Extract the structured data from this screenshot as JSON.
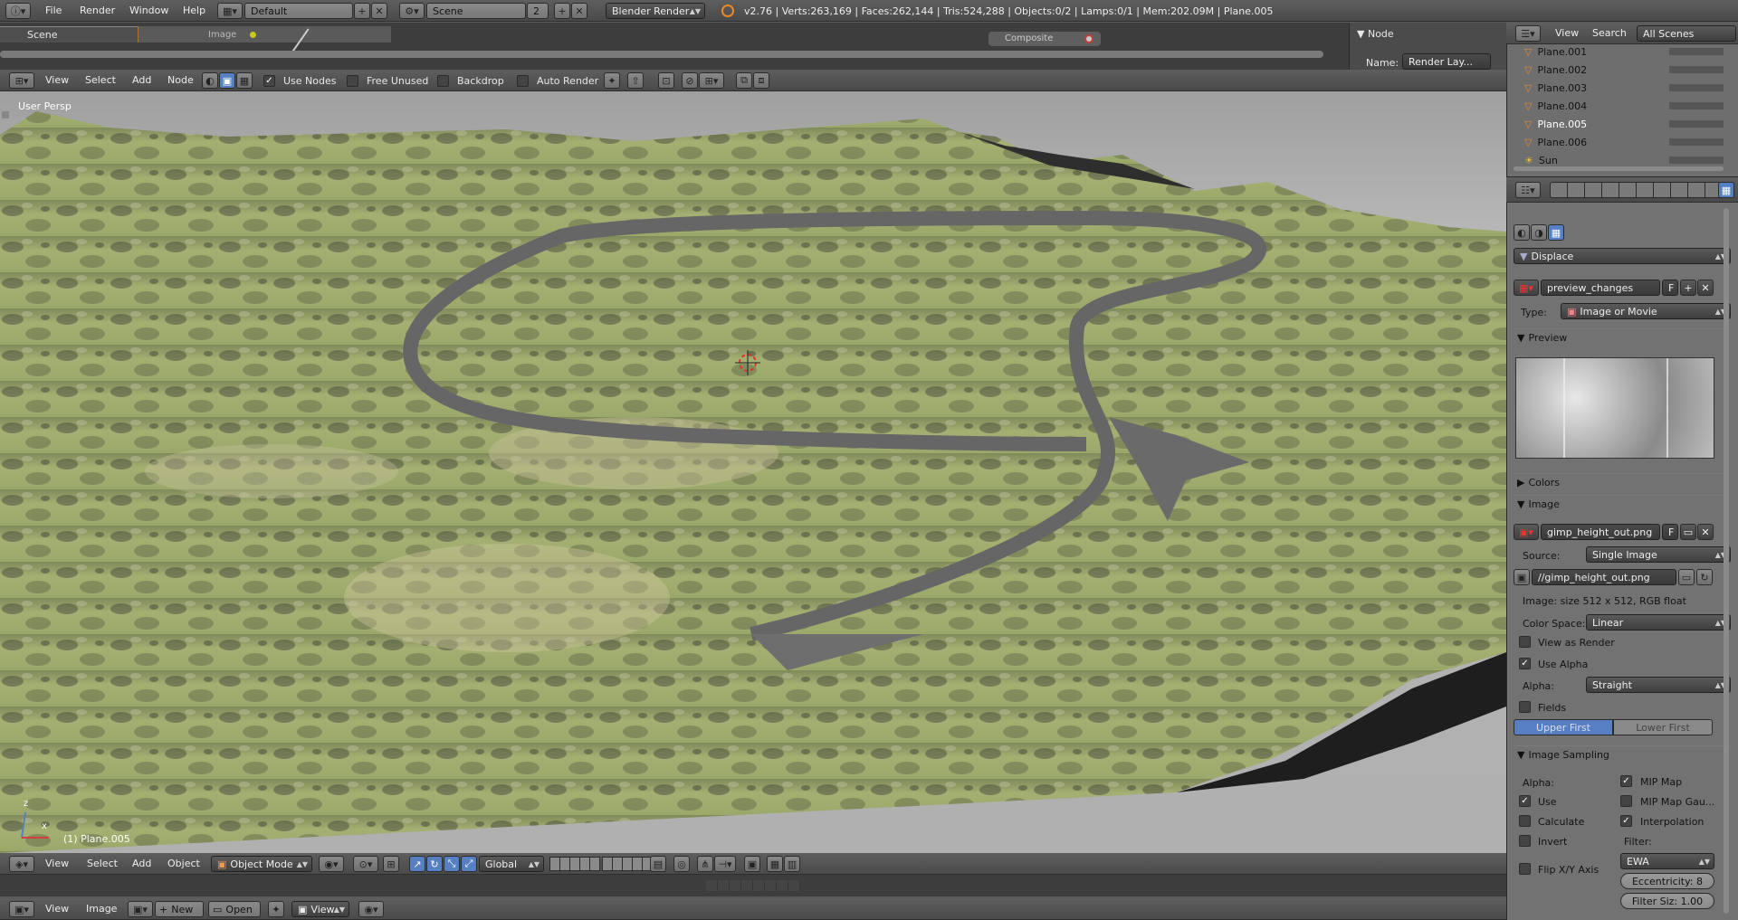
{
  "info_bar": {
    "menus": [
      "File",
      "Render",
      "Window",
      "Help"
    ],
    "screen_layout": "Default",
    "scene": "Scene",
    "scene_users": "2",
    "render_engine": "Blender Render",
    "stats": "v2.76 | Verts:263,169 | Faces:262,144 | Tris:524,288 | Objects:0/2 | Lamps:0/1 | Mem:202.09M | Plane.005"
  },
  "node_editor": {
    "tab_scene": "Scene",
    "tab_image": "Image",
    "node_composite": "Composite",
    "side_panel_title": "Node",
    "name_label": "Name:",
    "name_value": "Render Lay...",
    "menus": [
      "View",
      "Select",
      "Add",
      "Node"
    ],
    "use_nodes": "Use Nodes",
    "free_unused": "Free Unused",
    "backdrop": "Backdrop",
    "auto_render": "Auto Render",
    "use_nodes_checked": true
  },
  "viewport": {
    "view_label": "User Persp",
    "object_label": "(1) Plane.005",
    "axis_z": "z",
    "axis_x": "x",
    "menus": [
      "View",
      "Select",
      "Add",
      "Object"
    ],
    "mode": "Object Mode",
    "orientation": "Global"
  },
  "image_editor": {
    "menus": [
      "View",
      "Image"
    ],
    "new_label": "New",
    "open_label": "Open",
    "view_label": "View"
  },
  "outliner": {
    "menus": [
      "View",
      "Search"
    ],
    "display_mode": "All Scenes",
    "items": [
      "Plane.001",
      "Plane.002",
      "Plane.003",
      "Plane.004",
      "Plane.005",
      "Plane.006",
      "Sun"
    ]
  },
  "properties": {
    "texture_type_header": "Displace",
    "texture_name": "preview_changes",
    "fake_user": "F",
    "type_label": "Type:",
    "type_value": "Image or Movie",
    "preview_header": "Preview",
    "colors_header": "Colors",
    "image_header": "Image",
    "image_name": "gimp_height_out.png",
    "source_label": "Source:",
    "source_value": "Single Image",
    "filepath": "//gimp_height_out.png",
    "image_info": "Image: size 512 x 512, RGB float",
    "color_space_label": "Color Space:",
    "color_space_value": "Linear",
    "view_as_render": "View as Render",
    "use_alpha": "Use Alpha",
    "alpha_label": "Alpha:",
    "alpha_value": "Straight",
    "fields": "Fields",
    "upper_first": "Upper First",
    "lower_first": "Lower First",
    "sampling_header": "Image Sampling",
    "sampling_alpha": "Alpha:",
    "mip_map": "MIP Map",
    "use": "Use",
    "mip_map_gauss": "MIP Map Gau...",
    "calculate": "Calculate",
    "interpolation": "Interpolation",
    "invert": "Invert",
    "filter_label": "Filter:",
    "filter_value": "EWA",
    "flip_xy": "Flip X/Y Axis",
    "eccentricity": "Eccentricity: 8",
    "filter_size": "Filter Siz: 1.00"
  },
  "colors": {
    "accent_orange": "#e88a2a",
    "selected_blue": "#5680c2",
    "terrain_green": "#9aa86a",
    "road_gray": "#6e6e6e",
    "sky_gray": "#b5b5b5"
  }
}
